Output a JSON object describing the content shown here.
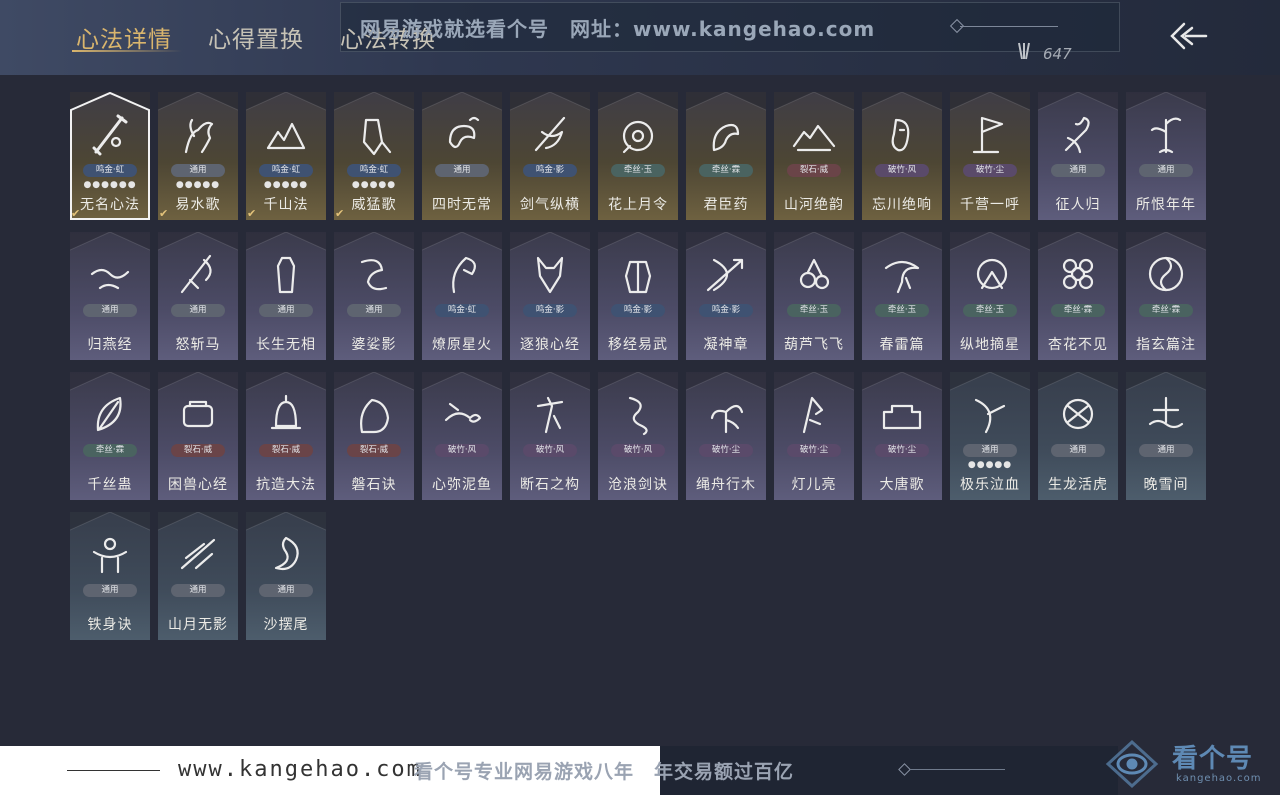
{
  "header": {
    "tabs": [
      {
        "label": "心法详情",
        "active": true
      },
      {
        "label": "心得置换",
        "active": false
      },
      {
        "label": "心法转换",
        "active": false
      }
    ],
    "currency": {
      "icon": "arrow-fan-icon",
      "value": "647"
    },
    "back_icon": "back-arrow-icon"
  },
  "watermark": {
    "top_banner": "网易游戏就选看个号　网址：www.kangehao.com",
    "bottom_url": "www.kangehao.com",
    "bottom_slogan": "看个号专业网易游戏八年　年交易额过百亿",
    "logo_text": "看个号",
    "logo_sub": "kangehao.com"
  },
  "colors": {
    "accent_gold": "#d9b56d",
    "background": "#272a38"
  },
  "cards": [
    {
      "name": "无名心法",
      "tag": "鸣金·虹",
      "tag_color": "blue",
      "dots": "●●●●●●",
      "tier": "gold",
      "selected": true,
      "checked": true,
      "icon": "sword-icon"
    },
    {
      "name": "易水歌",
      "tag": "通用",
      "tag_color": "gen",
      "dots": "●●●●●",
      "tier": "gold",
      "selected": false,
      "checked": true,
      "icon": "horse-icon"
    },
    {
      "name": "千山法",
      "tag": "鸣金·虹",
      "tag_color": "blue",
      "dots": "●●●●●",
      "tier": "gold",
      "selected": false,
      "checked": true,
      "icon": "mountain-icon"
    },
    {
      "name": "威猛歌",
      "tag": "鸣金·虹",
      "tag_color": "blue",
      "dots": "●●●●●",
      "tier": "gold",
      "selected": false,
      "checked": true,
      "icon": "fist-icon"
    },
    {
      "name": "四时无常",
      "tag": "通用",
      "tag_color": "gen",
      "dots": "",
      "tier": "gold",
      "selected": false,
      "checked": false,
      "icon": "swirl-icon"
    },
    {
      "name": "剑气纵横",
      "tag": "鸣金·影",
      "tag_color": "blue",
      "dots": "",
      "tier": "gold",
      "selected": false,
      "checked": false,
      "icon": "blade-icon"
    },
    {
      "name": "花上月令",
      "tag": "牵丝·玉",
      "tag_color": "teal",
      "dots": "",
      "tier": "gold",
      "selected": false,
      "checked": false,
      "icon": "flower-icon"
    },
    {
      "name": "君臣药",
      "tag": "牵丝·霖",
      "tag_color": "teal",
      "dots": "",
      "tier": "gold",
      "selected": false,
      "checked": false,
      "icon": "herb-icon"
    },
    {
      "name": "山河绝韵",
      "tag": "裂石·威",
      "tag_color": "red",
      "dots": "",
      "tier": "gold",
      "selected": false,
      "checked": false,
      "icon": "landscape-icon"
    },
    {
      "name": "忘川绝响",
      "tag": "破竹·风",
      "tag_color": "purp",
      "dots": "",
      "tier": "gold",
      "selected": false,
      "checked": false,
      "icon": "mask-icon"
    },
    {
      "name": "千营一呼",
      "tag": "破竹·尘",
      "tag_color": "purp",
      "dots": "",
      "tier": "gold",
      "selected": false,
      "checked": false,
      "icon": "flag-icon"
    },
    {
      "name": "征人归",
      "tag": "通用",
      "tag_color": "gen",
      "dots": "",
      "tier": "purple",
      "selected": false,
      "checked": false,
      "icon": "bird-hand-icon"
    },
    {
      "name": "所恨年年",
      "tag": "通用",
      "tag_color": "gen",
      "dots": "",
      "tier": "purple",
      "selected": false,
      "checked": false,
      "icon": "bamboo-icon"
    },
    {
      "name": "归燕经",
      "tag": "通用",
      "tag_color": "gen",
      "dots": "",
      "tier": "purple",
      "selected": false,
      "checked": false,
      "icon": "swallow-icon"
    },
    {
      "name": "怒斩马",
      "tag": "通用",
      "tag_color": "gen",
      "dots": "",
      "tier": "purple",
      "selected": false,
      "checked": false,
      "icon": "glaive-icon"
    },
    {
      "name": "长生无相",
      "tag": "通用",
      "tag_color": "gen",
      "dots": "",
      "tier": "purple",
      "selected": false,
      "checked": false,
      "icon": "figure-icon"
    },
    {
      "name": "婆娑影",
      "tag": "通用",
      "tag_color": "gen",
      "dots": "",
      "tier": "purple",
      "selected": false,
      "checked": false,
      "icon": "dragon-icon"
    },
    {
      "name": "燎原星火",
      "tag": "鸣金·虹",
      "tag_color": "blue",
      "dots": "",
      "tier": "purple",
      "selected": false,
      "checked": false,
      "icon": "scythe-icon"
    },
    {
      "name": "逐狼心经",
      "tag": "鸣金·影",
      "tag_color": "blue",
      "dots": "",
      "tier": "purple",
      "selected": false,
      "checked": false,
      "icon": "wolf-icon"
    },
    {
      "name": "移经易武",
      "tag": "鸣金·影",
      "tag_color": "blue",
      "dots": "",
      "tier": "purple",
      "selected": false,
      "checked": false,
      "icon": "armor-icon"
    },
    {
      "name": "凝神章",
      "tag": "鸣金·影",
      "tag_color": "blue",
      "dots": "",
      "tier": "purple",
      "selected": false,
      "checked": false,
      "icon": "bow-icon"
    },
    {
      "name": "葫芦飞飞",
      "tag": "牵丝·玉",
      "tag_color": "teal",
      "dots": "",
      "tier": "purple",
      "selected": false,
      "checked": false,
      "icon": "gourd-icon"
    },
    {
      "name": "春雷篇",
      "tag": "牵丝·玉",
      "tag_color": "teal",
      "dots": "",
      "tier": "purple",
      "selected": false,
      "checked": false,
      "icon": "storm-icon"
    },
    {
      "name": "纵地摘星",
      "tag": "牵丝·玉",
      "tag_color": "teal",
      "dots": "",
      "tier": "purple",
      "selected": false,
      "checked": false,
      "icon": "star-figure-icon"
    },
    {
      "name": "杏花不见",
      "tag": "牵丝·霖",
      "tag_color": "teal",
      "dots": "",
      "tier": "purple",
      "selected": false,
      "checked": false,
      "icon": "blossom-icon"
    },
    {
      "name": "指玄篇注",
      "tag": "牵丝·霖",
      "tag_color": "teal",
      "dots": "",
      "tier": "purple",
      "selected": false,
      "checked": false,
      "icon": "yinyang-icon"
    },
    {
      "name": "千丝蛊",
      "tag": "牵丝·霖",
      "tag_color": "teal",
      "dots": "",
      "tier": "purple",
      "selected": false,
      "checked": false,
      "icon": "leaf-icon"
    },
    {
      "name": "困兽心经",
      "tag": "裂石·威",
      "tag_color": "red",
      "dots": "",
      "tier": "purple",
      "selected": false,
      "checked": false,
      "icon": "shackle-icon"
    },
    {
      "name": "抗造大法",
      "tag": "裂石·威",
      "tag_color": "red",
      "dots": "",
      "tier": "purple",
      "selected": false,
      "checked": false,
      "icon": "bell-icon"
    },
    {
      "name": "磐石诀",
      "tag": "裂石·威",
      "tag_color": "red",
      "dots": "",
      "tier": "purple",
      "selected": false,
      "checked": false,
      "icon": "boulder-icon"
    },
    {
      "name": "心弥泥鱼",
      "tag": "破竹·风",
      "tag_color": "purp",
      "dots": "",
      "tier": "purple",
      "selected": false,
      "checked": false,
      "icon": "fish-icon"
    },
    {
      "name": "断石之构",
      "tag": "破竹·风",
      "tag_color": "purp",
      "dots": "",
      "tier": "purple",
      "selected": false,
      "checked": false,
      "icon": "warrior-icon"
    },
    {
      "name": "沧浪剑诀",
      "tag": "破竹·风",
      "tag_color": "purp",
      "dots": "",
      "tier": "purple",
      "selected": false,
      "checked": false,
      "icon": "serpent-icon"
    },
    {
      "name": "绳舟行木",
      "tag": "破竹·尘",
      "tag_color": "purp",
      "dots": "",
      "tier": "purple",
      "selected": false,
      "checked": false,
      "icon": "tree-icon"
    },
    {
      "name": "灯儿亮",
      "tag": "破竹·尘",
      "tag_color": "purp",
      "dots": "",
      "tier": "purple",
      "selected": false,
      "checked": false,
      "icon": "lamp-icon"
    },
    {
      "name": "大唐歌",
      "tag": "破竹·尘",
      "tag_color": "purp",
      "dots": "",
      "tier": "purple",
      "selected": false,
      "checked": false,
      "icon": "wall-icon"
    },
    {
      "name": "极乐泣血",
      "tag": "通用",
      "tag_color": "gen",
      "dots": "●●●●●",
      "tier": "slate",
      "selected": false,
      "checked": false,
      "icon": "slash-icon"
    },
    {
      "name": "生龙活虎",
      "tag": "通用",
      "tag_color": "gen",
      "dots": "",
      "tier": "slate",
      "selected": false,
      "checked": false,
      "icon": "pinwheel-icon"
    },
    {
      "name": "晚雪间",
      "tag": "通用",
      "tag_color": "gen",
      "dots": "",
      "tier": "slate",
      "selected": false,
      "checked": false,
      "icon": "cross-wave-icon"
    },
    {
      "name": "铁身诀",
      "tag": "通用",
      "tag_color": "gen",
      "dots": "",
      "tier": "slate",
      "selected": false,
      "checked": false,
      "icon": "muscle-icon"
    },
    {
      "name": "山月无影",
      "tag": "通用",
      "tag_color": "gen",
      "dots": "",
      "tier": "slate",
      "selected": false,
      "checked": false,
      "icon": "feather-icon"
    },
    {
      "name": "沙摆尾",
      "tag": "通用",
      "tag_color": "gen",
      "dots": "",
      "tier": "slate",
      "selected": false,
      "checked": false,
      "icon": "wave-icon"
    }
  ]
}
